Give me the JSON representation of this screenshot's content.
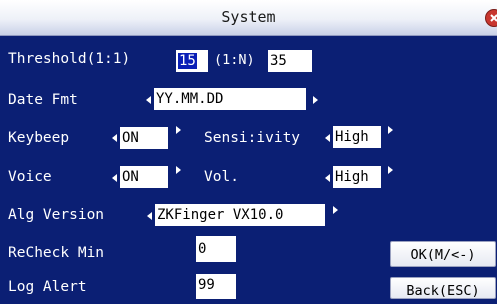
{
  "window": {
    "title": "System"
  },
  "threshold": {
    "label": "Threshold(1:1)",
    "value_1_1": "15",
    "label_1_n": "(1:N)",
    "value_1_n": "35"
  },
  "date_fmt": {
    "label": "Date Fmt",
    "value": "YY.MM.DD"
  },
  "keybeep": {
    "label": "Keybeep",
    "value": "ON"
  },
  "sensitivity": {
    "label": "Sensi:ivity",
    "value": "High"
  },
  "voice": {
    "label": "Voice",
    "value": "ON"
  },
  "vol": {
    "label": "Vol.",
    "value": "High"
  },
  "alg_version": {
    "label": "Alg Version",
    "value": "ZKFinger VX10.0"
  },
  "recheck_min": {
    "label": "ReCheck Min",
    "value": "0"
  },
  "log_alert": {
    "label": "Log Alert",
    "value": "99"
  },
  "buttons": {
    "ok": "OK(M/<-)",
    "back": "Back(ESC)"
  },
  "colors": {
    "background": "#0b1f74",
    "selection": "#0a1fb6",
    "close": "#c8362f"
  }
}
